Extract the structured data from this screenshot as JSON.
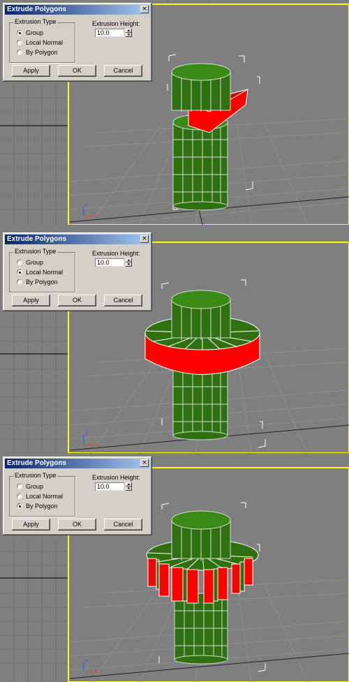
{
  "dialog": {
    "title": "Extrude Polygons",
    "close_glyph": "×",
    "extrusion_type_label": "Extrusion Type",
    "options": [
      "Group",
      "Local Normal",
      "By Polygon"
    ],
    "height_label": "Extrusion Height:",
    "height_value": "10.0",
    "buttons": {
      "apply": "Apply",
      "ok": "OK",
      "cancel": "Cancel"
    }
  },
  "panels": [
    {
      "selected_option": "Group",
      "extrusion_mode": "group"
    },
    {
      "selected_option": "Local Normal",
      "extrusion_mode": "local-normal"
    },
    {
      "selected_option": "By Polygon",
      "extrusion_mode": "by-polygon"
    }
  ],
  "colors": {
    "viewport_bg": "#7f7f7f",
    "viewport_border": "#ffff00",
    "dialog_bg": "#d4d0c8",
    "title_bar": "#0a246a",
    "mesh_green": "#2a6a0a",
    "extrude_red": "#ff0000"
  },
  "icons": [
    "close-icon",
    "spinner-up-icon",
    "spinner-down-icon",
    "axis-gizmo-icon",
    "radio-icon"
  ]
}
